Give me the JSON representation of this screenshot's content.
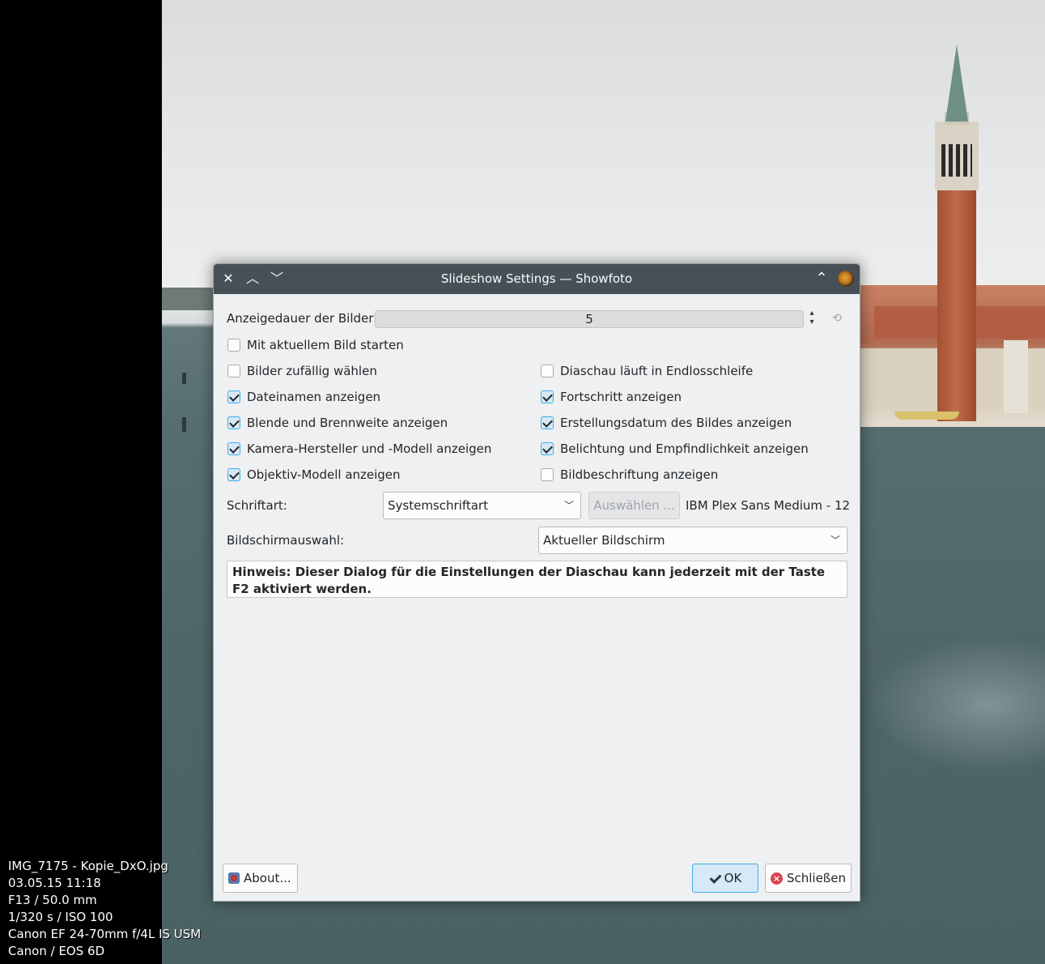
{
  "overlay": {
    "filename": "IMG_7175 - Kopie_DxO.jpg",
    "date": "03.05.15 11:18",
    "aperture_focal": "F13 / 50.0 mm",
    "exposure_iso": "1/320 s / ISO 100",
    "lens": "Canon EF 24-70mm f/4L IS USM",
    "camera": "Canon / EOS 6D"
  },
  "window": {
    "title": "Slideshow Settings — Showfoto",
    "close_glyph": "✕",
    "up_glyph": "︿",
    "down_glyph": "﹀",
    "keep_above_glyph": "⌃",
    "app_icon": "showfoto-app-icon"
  },
  "settings": {
    "delay_label": "Anzeigedauer der Bilder:",
    "delay_value": "5",
    "spin_arrows": "⌃⌄",
    "reset_icon": "⟲",
    "start_current": {
      "label": "Mit aktuellem Bild starten",
      "checked": false
    },
    "shuffle": {
      "label": "Bilder zufällig wählen",
      "checked": false
    },
    "loop": {
      "label": "Diaschau läuft in Endlosschleife",
      "checked": false
    },
    "show_filenames": {
      "label": "Dateinamen anzeigen",
      "checked": true
    },
    "show_progress": {
      "label": "Fortschritt anzeigen",
      "checked": true
    },
    "show_aperture": {
      "label": "Blende und Brennweite anzeigen",
      "checked": true
    },
    "show_date": {
      "label": "Erstellungsdatum des Bildes anzeigen",
      "checked": true
    },
    "show_camera": {
      "label": "Kamera-Hersteller und -Modell anzeigen",
      "checked": true
    },
    "show_exposure": {
      "label": "Belichtung und Empfindlichkeit anzeigen",
      "checked": true
    },
    "show_lens": {
      "label": "Objektiv-Modell anzeigen",
      "checked": true
    },
    "show_caption": {
      "label": "Bildbeschriftung anzeigen",
      "checked": false
    },
    "font_label": "Schriftart:",
    "font_combo_value": "Systemschriftart",
    "font_choose_button": "Auswählen ...",
    "font_current": "IBM Plex Sans Medium - 12",
    "screen_label": "Bildschirmauswahl:",
    "screen_combo_value": "Aktueller Bildschirm",
    "chevron": "⌄",
    "hint": "Hinweis: Dieser Dialog für die Einstellungen der Diaschau kann jederzeit mit der Taste F2 aktiviert werden."
  },
  "buttons": {
    "about": "About...",
    "ok": "OK",
    "close": "Schließen",
    "close_icon_glyph": "×"
  },
  "colors": {
    "titlebar": "#475057",
    "accent": "#3daee9",
    "dialog_bg": "#eff0f1"
  }
}
